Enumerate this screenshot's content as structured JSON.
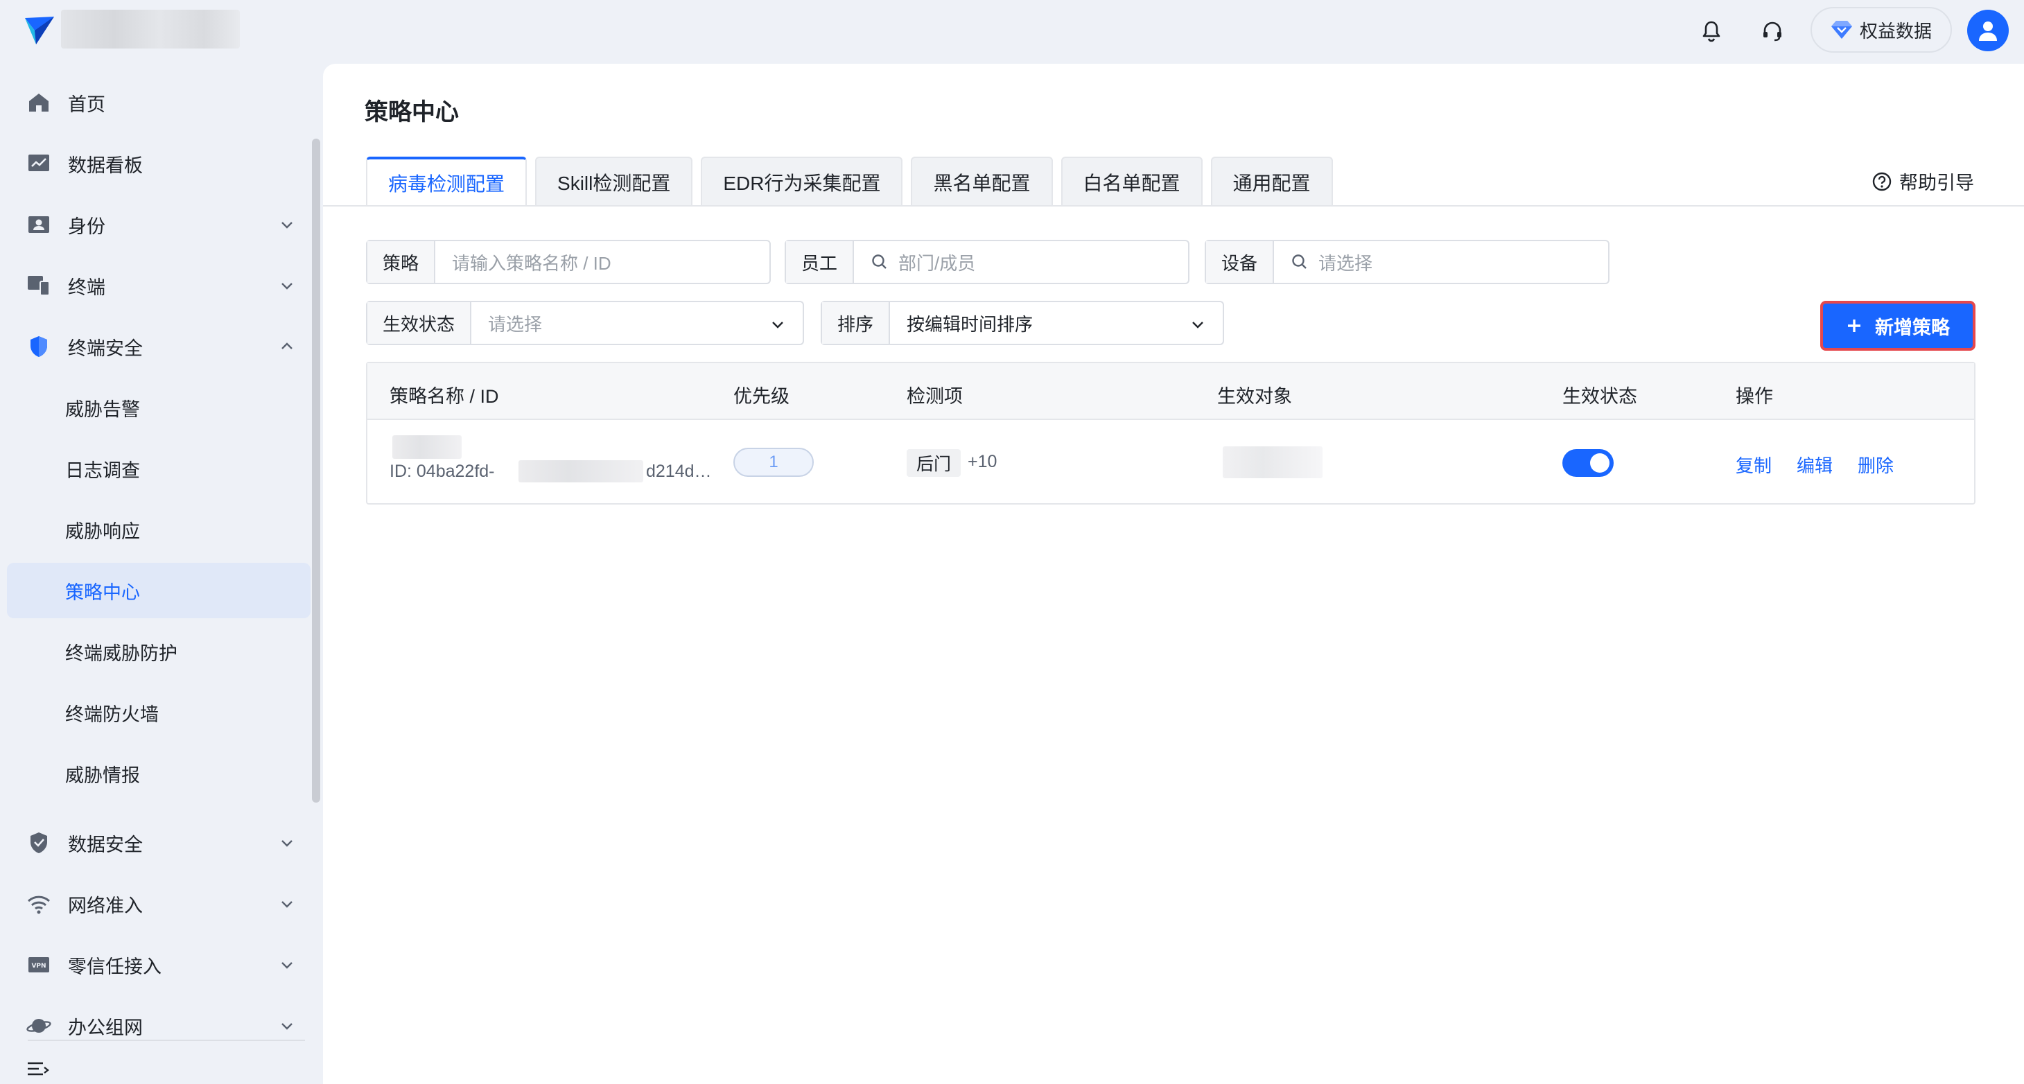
{
  "colors": {
    "accent": "#1966ff",
    "highlight_border": "#e5484d",
    "sidebar_bg": "#eef1f7"
  },
  "topbar": {
    "icons": [
      "bell-icon",
      "headset-icon"
    ],
    "rights_label": "权益数据"
  },
  "sidebar": {
    "items": [
      {
        "label": "首页",
        "icon": "home-icon"
      },
      {
        "label": "数据看板",
        "icon": "dashboard-icon"
      },
      {
        "label": "身份",
        "icon": "id-card-icon"
      },
      {
        "label": "终端",
        "icon": "devices-icon"
      },
      {
        "label": "终端安全",
        "icon": "shield-icon"
      },
      {
        "label": "数据安全",
        "icon": "shield-check-icon"
      },
      {
        "label": "网络准入",
        "icon": "wifi-icon"
      },
      {
        "label": "零信任接入",
        "icon": "vpn-icon"
      },
      {
        "label": "办公组网",
        "icon": "planet-icon"
      }
    ],
    "sub_items": [
      "威胁告警",
      "日志调查",
      "威胁响应",
      "策略中心",
      "终端威胁防护",
      "终端防火墙",
      "威胁情报"
    ],
    "active_sub": "策略中心"
  },
  "main": {
    "title": "策略中心",
    "tabs": [
      "病毒检测配置",
      "Skill检测配置",
      "EDR行为采集配置",
      "黑名单配置",
      "白名单配置",
      "通用配置"
    ],
    "active_tab": "病毒检测配置",
    "help_label": "帮助引导",
    "filters": {
      "policy": {
        "label": "策略",
        "placeholder": "请输入策略名称 / ID"
      },
      "employee": {
        "label": "员工",
        "placeholder": "部门/成员"
      },
      "device": {
        "label": "设备",
        "placeholder": "请选择"
      },
      "status": {
        "label": "生效状态",
        "placeholder": "请选择"
      },
      "sort": {
        "label": "排序",
        "value": "按编辑时间排序"
      }
    },
    "add_button": "新增策略",
    "table": {
      "columns": [
        "策略名称 / ID",
        "优先级",
        "检测项",
        "生效对象",
        "生效状态",
        "操作"
      ],
      "rows": [
        {
          "id_prefix": "ID: 04ba22fd-",
          "id_suffix": "d214d…",
          "priority": "1",
          "detection_tag": "后门",
          "detection_more": "+10",
          "enabled": true,
          "actions": [
            "复制",
            "编辑",
            "删除"
          ]
        }
      ]
    }
  }
}
